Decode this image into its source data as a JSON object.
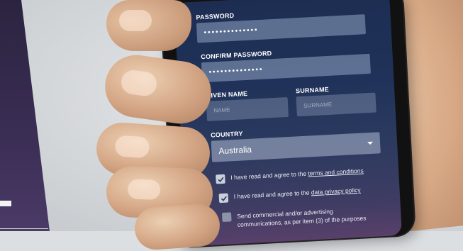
{
  "form": {
    "password": {
      "label": "PASSWORD",
      "value": "••••••••••••••"
    },
    "confirm_password": {
      "label": "CONFIRM PASSWORD",
      "value": "••••••••••••••"
    },
    "given_name": {
      "label": "GIVEN NAME",
      "placeholder": "NAME"
    },
    "surname": {
      "label": "SURNAME",
      "placeholder": "SURNAME"
    },
    "country": {
      "label": "COUNTRY",
      "value": "Australia"
    },
    "checkboxes": [
      {
        "prefix": "I have read and agree to the ",
        "link": "terms and conditions",
        "checked": true
      },
      {
        "prefix": "I have read and agree to the ",
        "link": "data privacy policy",
        "checked": true
      },
      {
        "text": "Send commercial and/or advertising communications, as per item (3) of the purposes",
        "checked": false
      }
    ]
  },
  "colors": {
    "screen_top": "#1d2d52",
    "screen_bottom": "#58406a",
    "left_panel": "#3b2e55",
    "skin": "#d7a884"
  }
}
